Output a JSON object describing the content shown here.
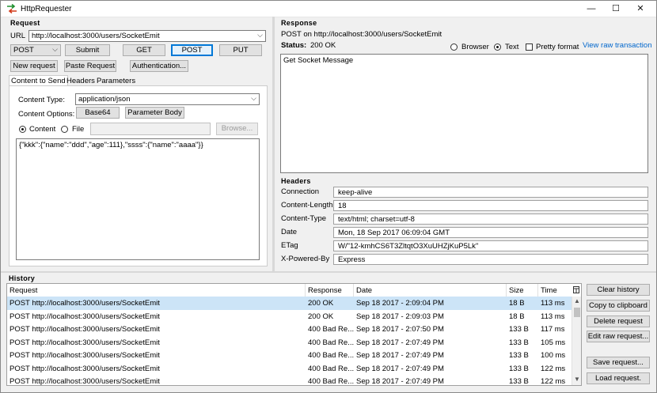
{
  "window": {
    "title": "HttpRequester",
    "minimize": "—",
    "maximize": "☐",
    "close": "✕"
  },
  "request": {
    "header": "Request",
    "url_label": "URL",
    "url": "http://localhost:3000/users/SocketEmit",
    "method": "POST",
    "submit": "Submit",
    "get": "GET",
    "post": "POST",
    "put": "PUT",
    "new_request": "New request",
    "paste_request": "Paste Request",
    "authentication": "Authentication...",
    "tabs": [
      "Content to Send",
      "Headers",
      "Parameters"
    ],
    "content_type_label": "Content Type:",
    "content_type": "application/json",
    "content_options_label": "Content Options:",
    "base64": "Base64",
    "parameter_body": "Parameter Body",
    "content_radio": "Content",
    "file_radio": "File",
    "browse": "Browse...",
    "body": "{\"kkk\":{\"name\":\"ddd\",\"age\":111},\"ssss\":{\"name\":\"aaaa\"}}"
  },
  "response": {
    "header": "Response",
    "line": "POST on http://localhost:3000/users/SocketEmit",
    "status_label": "Status:",
    "status": "200 OK",
    "browser": "Browser",
    "text": "Text",
    "pretty": "Pretty format",
    "raw_link": "View raw transaction",
    "body": "Get Socket Message"
  },
  "headers": {
    "header": "Headers",
    "rows": [
      {
        "name": "Connection",
        "value": "keep-alive"
      },
      {
        "name": "Content-Length",
        "value": "18"
      },
      {
        "name": "Content-Type",
        "value": "text/html; charset=utf-8"
      },
      {
        "name": "Date",
        "value": "Mon, 18 Sep 2017 06:09:04 GMT"
      },
      {
        "name": "ETag",
        "value": "W/\"12-kmhCS6T3ZltqtO3XuUHZjKuP5Lk\""
      },
      {
        "name": "X-Powered-By",
        "value": "Express"
      }
    ]
  },
  "history": {
    "header": "History",
    "columns": [
      "Request",
      "Response",
      "Date",
      "Size",
      "Time"
    ],
    "rows": [
      {
        "request": "POST http://localhost:3000/users/SocketEmit",
        "response": "200 OK",
        "date": "Sep 18 2017 - 2:09:04 PM",
        "size": "18 B",
        "time": "113 ms"
      },
      {
        "request": "POST http://localhost:3000/users/SocketEmit",
        "response": "200 OK",
        "date": "Sep 18 2017 - 2:09:03 PM",
        "size": "18 B",
        "time": "113 ms"
      },
      {
        "request": "POST http://localhost:3000/users/SocketEmit",
        "response": "400 Bad Re...",
        "date": "Sep 18 2017 - 2:07:50 PM",
        "size": "133 B",
        "time": "117 ms"
      },
      {
        "request": "POST http://localhost:3000/users/SocketEmit",
        "response": "400 Bad Re...",
        "date": "Sep 18 2017 - 2:07:49 PM",
        "size": "133 B",
        "time": "105 ms"
      },
      {
        "request": "POST http://localhost:3000/users/SocketEmit",
        "response": "400 Bad Re...",
        "date": "Sep 18 2017 - 2:07:49 PM",
        "size": "133 B",
        "time": "100 ms"
      },
      {
        "request": "POST http://localhost:3000/users/SocketEmit",
        "response": "400 Bad Re...",
        "date": "Sep 18 2017 - 2:07:49 PM",
        "size": "133 B",
        "time": "122 ms"
      },
      {
        "request": "POST http://localhost:3000/users/SocketEmit",
        "response": "400 Bad Re...",
        "date": "Sep 18 2017 - 2:07:49 PM",
        "size": "133 B",
        "time": "122 ms"
      }
    ],
    "buttons": {
      "clear": "Clear history",
      "copy": "Copy to clipboard",
      "delete": "Delete request",
      "edit": "Edit raw request...",
      "save": "Save request...",
      "load": "Load request."
    }
  }
}
